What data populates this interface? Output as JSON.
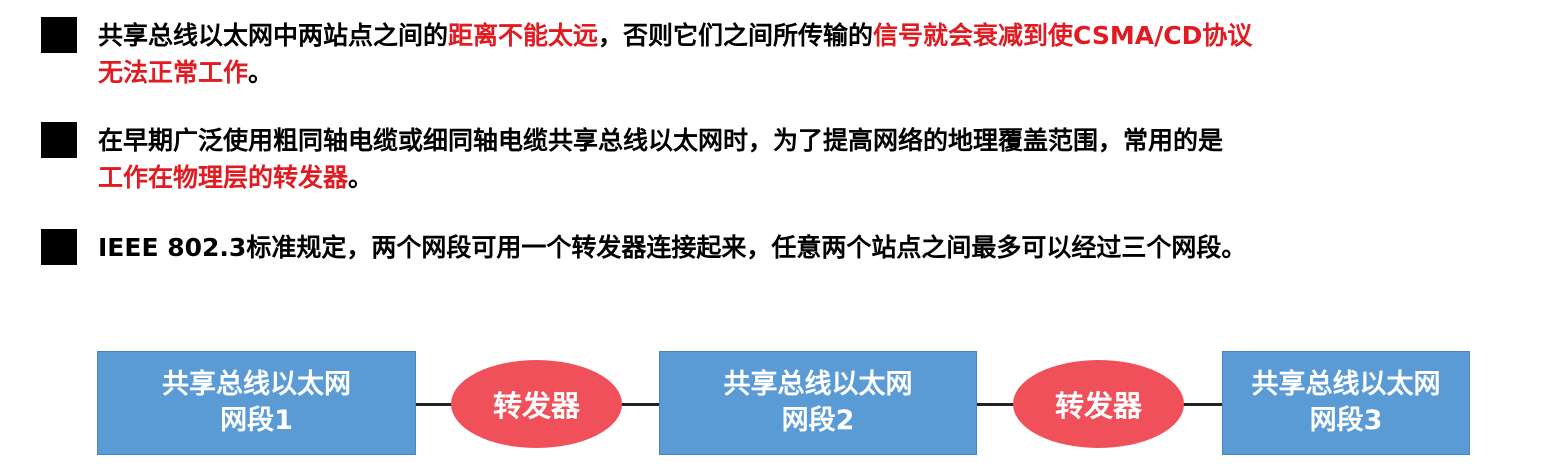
{
  "bullets": [
    {
      "lines": [
        [
          {
            "text": "共享总线以太网中两站点之间的",
            "red": false
          },
          {
            "text": "距离不能太远",
            "red": true
          },
          {
            "text": "，否则它们之间所传输的",
            "red": false
          },
          {
            "text": "信号就会衰减到使CSMA/CD协议",
            "red": true
          }
        ],
        [
          {
            "text": "无法正常工作",
            "red": true
          },
          {
            "text": "。",
            "red": false
          }
        ]
      ]
    },
    {
      "lines": [
        [
          {
            "text": "在早期广泛使用粗同轴电缆或细同轴电缆共享总线以太网时，为了提高网络的地理覆盖范围，常用的是",
            "red": false
          }
        ],
        [
          {
            "text": "工作在物理层的转发器",
            "red": true
          },
          {
            "text": "。",
            "red": false
          }
        ]
      ]
    },
    {
      "lines": [
        [
          {
            "text": "IEEE 802.3标准规定，两个网段可用一个转发器连接起来，任意两个站点之间最多可以经过三个网段。",
            "red": false
          }
        ]
      ]
    }
  ],
  "diagram": {
    "segments": [
      {
        "line1": "共享总线以太网",
        "line2": "网段1"
      },
      {
        "line1": "共享总线以太网",
        "line2": "网段2"
      },
      {
        "line1": "共享总线以太网",
        "line2": "网段3"
      }
    ],
    "repeaters": [
      {
        "label": "转发器"
      },
      {
        "label": "转发器"
      }
    ]
  },
  "colors": {
    "highlight_red": "#e01b22",
    "segment_blue": "#5b9bd5",
    "repeater_red": "#f0505a"
  }
}
